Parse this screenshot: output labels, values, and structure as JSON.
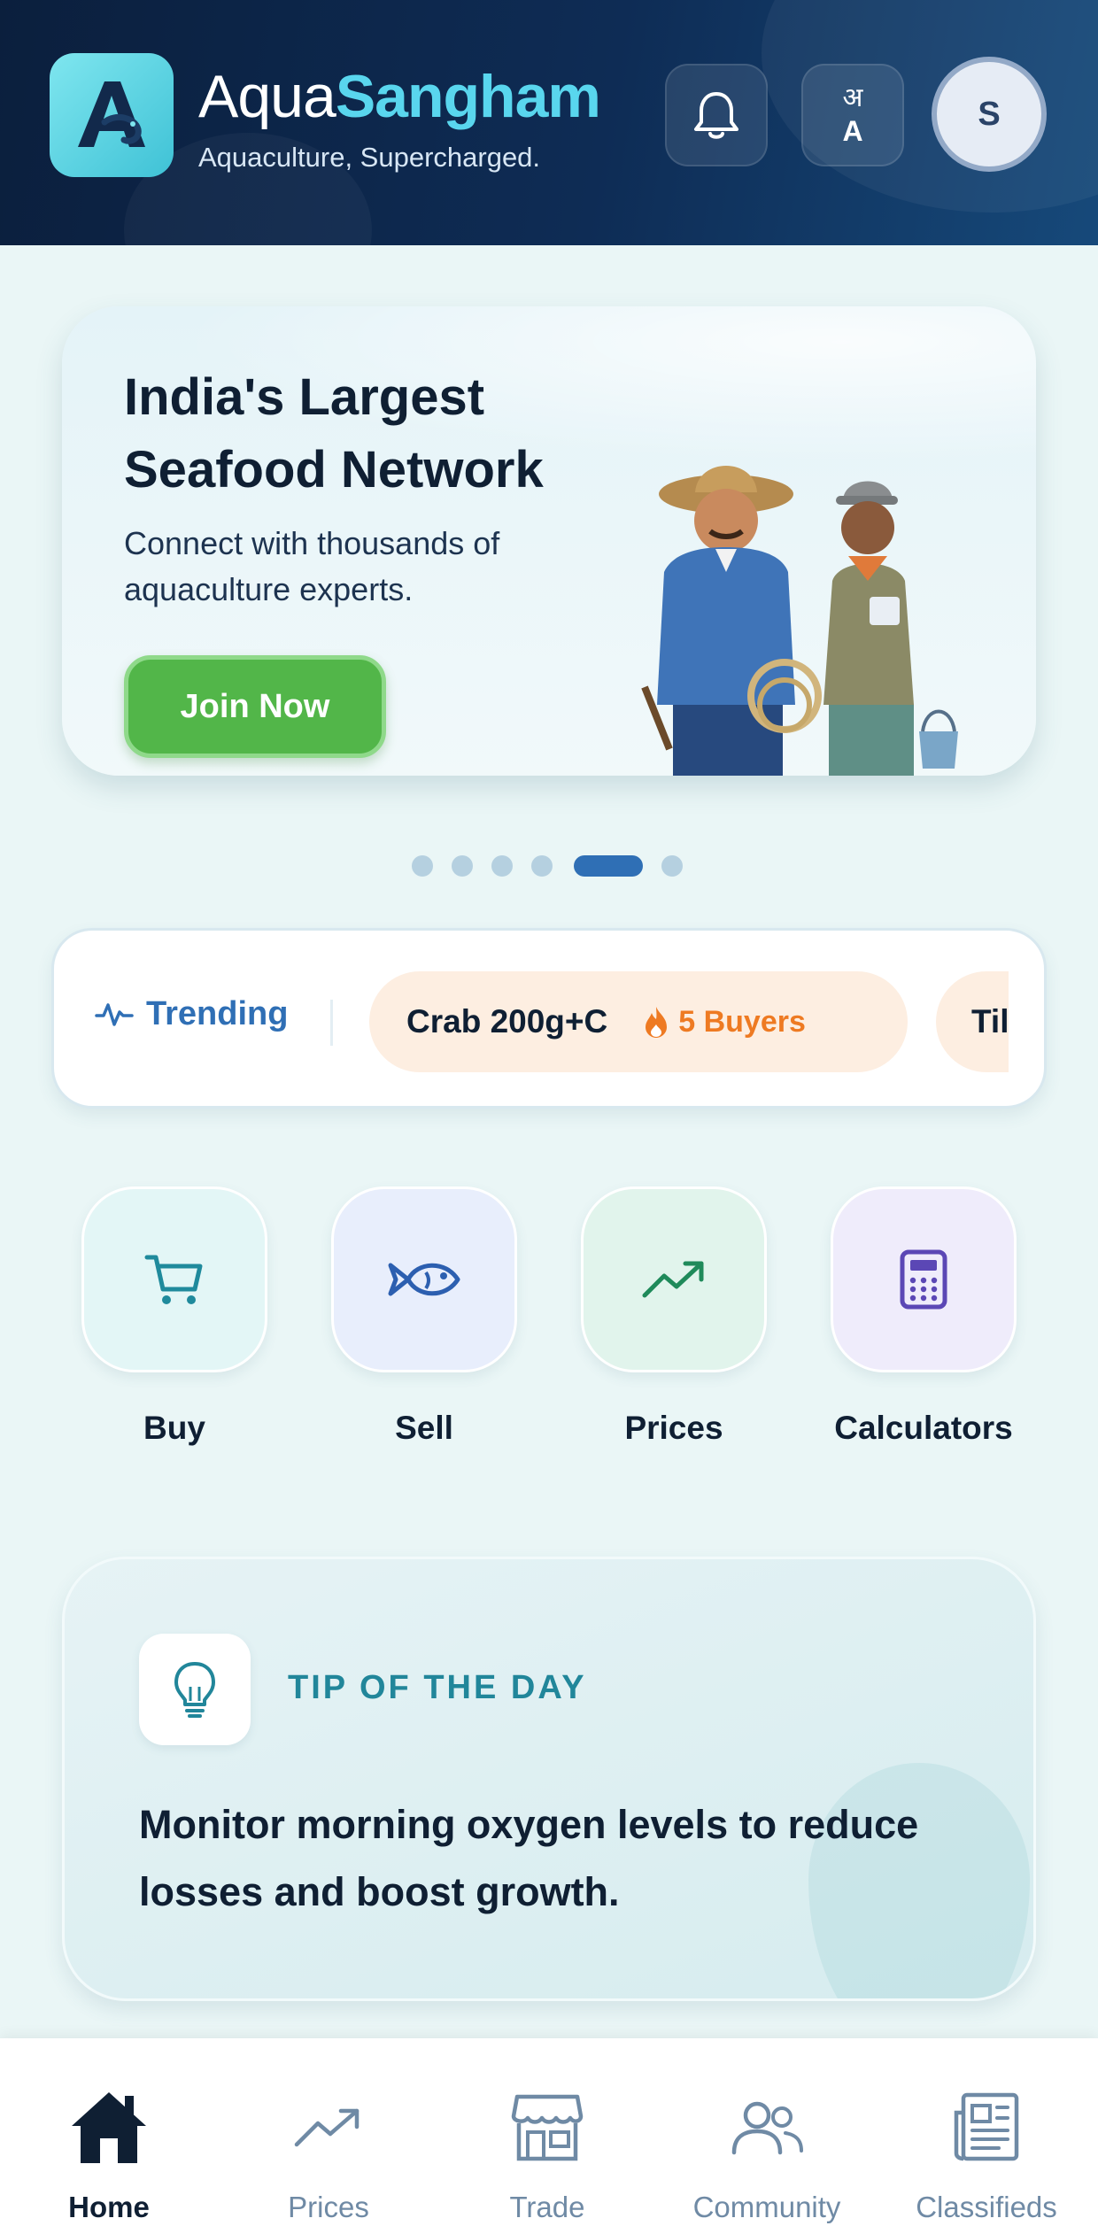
{
  "header": {
    "brand_part1": "Aqua",
    "brand_part2": "Sangham",
    "tagline": "Aquaculture, Supercharged.",
    "lang_top": "अ",
    "lang_bottom": "A",
    "avatar_initial": "S",
    "icons": {
      "logo": "shrimp-a-logo",
      "bell": "bell-icon"
    },
    "colors": {
      "bg": "#0b1f3d",
      "accent": "#59d6ee"
    }
  },
  "hero": {
    "title": "India's Largest Seafood Network",
    "subtitle": "Connect with thousands of aquaculture experts.",
    "cta": "Join Now",
    "cta_color": "#52b649",
    "slides_total": 6,
    "slide_active": 5
  },
  "trending": {
    "label": "Trending",
    "items": [
      {
        "name": "Crab 200g+C",
        "buyers": "5 Buyers"
      },
      {
        "name": "Tila"
      }
    ]
  },
  "quick_actions": [
    {
      "label": "Buy",
      "icon": "cart-icon"
    },
    {
      "label": "Sell",
      "icon": "fish-icon"
    },
    {
      "label": "Prices",
      "icon": "trending-up-icon"
    },
    {
      "label": "Calculators",
      "icon": "calculator-icon"
    }
  ],
  "tip": {
    "heading": "TIP OF THE DAY",
    "text": "Monitor morning oxygen levels to reduce losses and boost growth.",
    "icon": "lightbulb-icon"
  },
  "bottom_nav": [
    {
      "label": "Home",
      "icon": "home-icon",
      "active": true
    },
    {
      "label": "Prices",
      "icon": "trending-up-icon",
      "active": false
    },
    {
      "label": "Trade",
      "icon": "store-icon",
      "active": false
    },
    {
      "label": "Community",
      "icon": "users-icon",
      "active": false
    },
    {
      "label": "Classifieds",
      "icon": "newspaper-icon",
      "active": false
    }
  ]
}
